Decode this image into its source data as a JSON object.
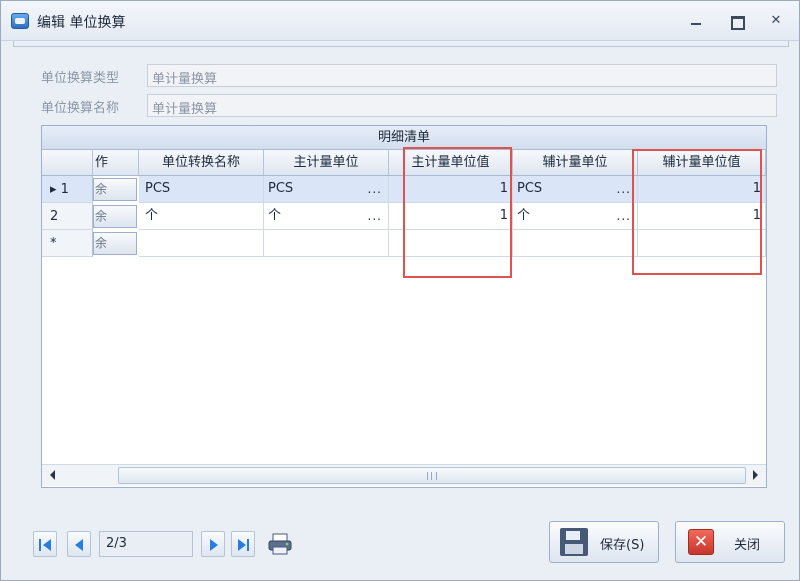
{
  "window": {
    "title": "编辑 单位换算"
  },
  "form": {
    "type_label": "单位换算类型",
    "type_value": "单计量换算",
    "name_label": "单位换算名称",
    "name_value": "单计量换算"
  },
  "grid": {
    "caption": "明细清单",
    "columns": [
      "作",
      "单位转换名称",
      "主计量单位",
      "主计量单位值",
      "辅计量单位",
      "辅计量单位值"
    ],
    "op_label": "余",
    "rows": [
      {
        "indicator": "▸ 1",
        "name": "PCS",
        "main_unit": "PCS",
        "main_value": "1",
        "aux_unit": "PCS",
        "aux_value": "1"
      },
      {
        "indicator": "2",
        "name": "个",
        "main_unit": "个",
        "main_value": "1",
        "aux_unit": "个",
        "aux_value": "1"
      },
      {
        "indicator": "*",
        "name": "",
        "main_unit": "",
        "main_value": "",
        "aux_unit": "",
        "aux_value": ""
      }
    ],
    "ellipsis": "..."
  },
  "navigator": {
    "page": "2/3"
  },
  "buttons": {
    "save": "保存(S)",
    "close": "关闭"
  },
  "colors": {
    "accent": "#2a7de0",
    "highlight_box": "#e05252",
    "selected_row": "#dae6f7"
  }
}
